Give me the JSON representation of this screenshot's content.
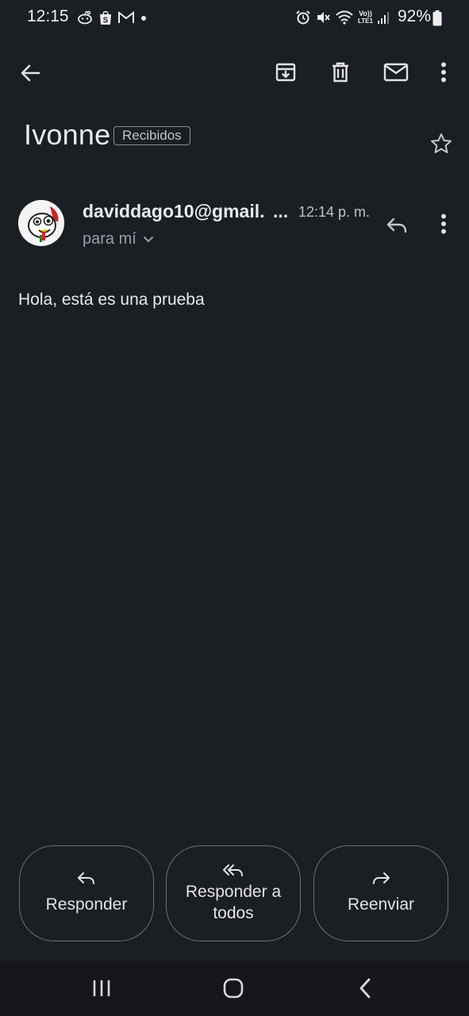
{
  "status_bar": {
    "time": "12:15",
    "battery_percent": "92%",
    "notification_icons": [
      "reddit-icon",
      "shopee-icon",
      "gmail-icon",
      "dot-icon"
    ],
    "system_icons": [
      "alarm-icon",
      "mute-icon",
      "wifi-icon",
      "volte-icon",
      "signal-icon",
      "battery-icon"
    ],
    "volte_text": "Vo))",
    "lte_text": "LTE1"
  },
  "toolbar": {
    "icons": [
      "back-arrow-icon",
      "archive-icon",
      "delete-icon",
      "mark-unread-icon",
      "more-vert-icon"
    ]
  },
  "email": {
    "subject": "Ivonne",
    "label": "Recibidos",
    "sender": "daviddago10@gmail.",
    "sender_ellipsis": "...",
    "time": "12:14 p. m.",
    "recipient": "para mí",
    "body": "Hola, está es una prueba"
  },
  "actions": {
    "reply": "Responder",
    "reply_all_line1": "Responder a",
    "reply_all_line2": "todos",
    "forward": "Reenviar"
  },
  "colors": {
    "background": "#1b1e22",
    "nav_bar": "#15171b",
    "text_primary": "#e8eaed",
    "text_secondary": "#9aa0a6"
  }
}
